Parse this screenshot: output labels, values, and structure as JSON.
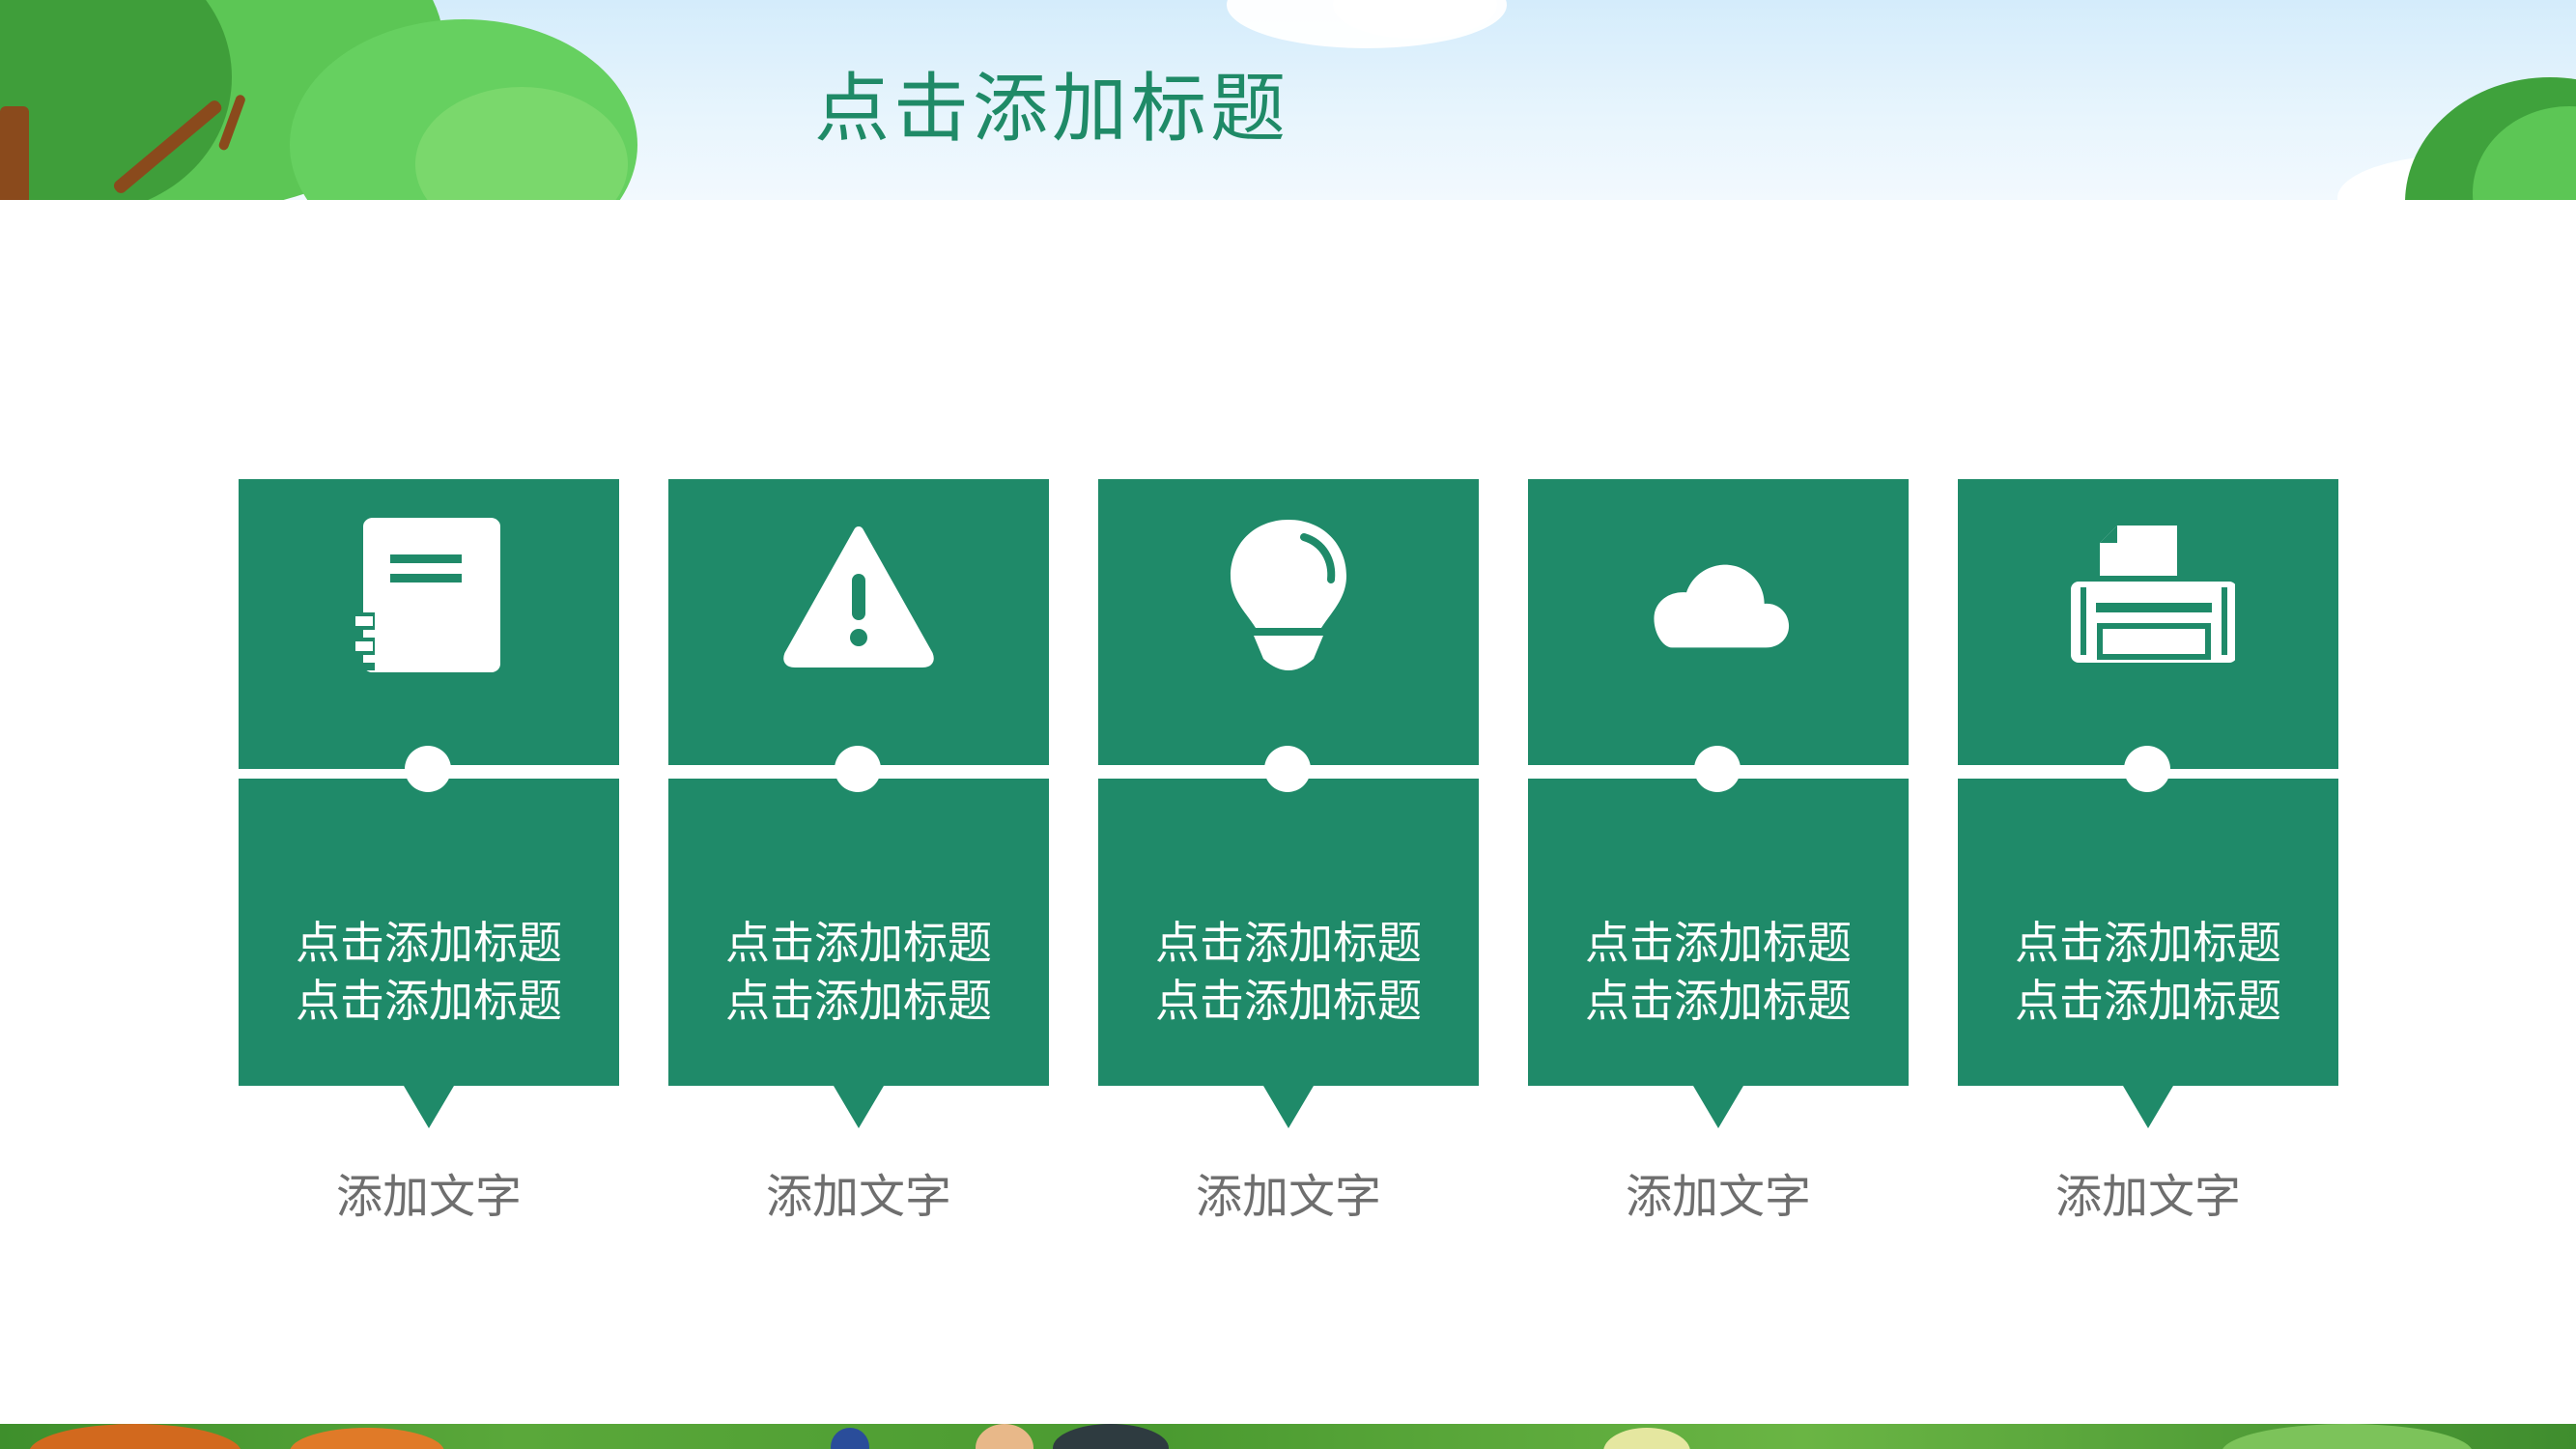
{
  "title": "点击添加标题",
  "colors": {
    "accent": "#1f8a69",
    "title": "#1f8a67",
    "caption": "#6e6e6e",
    "card_text": "#ffffff"
  },
  "cards": [
    {
      "icon": "notebook-icon",
      "line1": "点击添加标题",
      "line2": "点击添加标题",
      "caption": "添加文字"
    },
    {
      "icon": "warning-icon",
      "line1": "点击添加标题",
      "line2": "点击添加标题",
      "caption": "添加文字"
    },
    {
      "icon": "lightbulb-icon",
      "line1": "点击添加标题",
      "line2": "点击添加标题",
      "caption": "添加文字"
    },
    {
      "icon": "cloud-icon",
      "line1": "点击添加标题",
      "line2": "点击添加标题",
      "caption": "添加文字"
    },
    {
      "icon": "printer-icon",
      "line1": "点击添加标题",
      "line2": "点击添加标题",
      "caption": "添加文字"
    }
  ]
}
